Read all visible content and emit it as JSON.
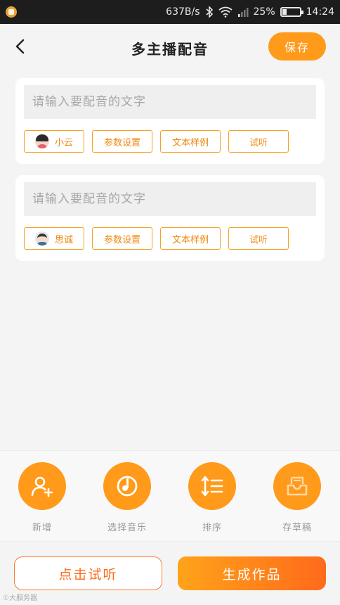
{
  "status_bar": {
    "speed": "637B/s",
    "battery": "25%",
    "battery_level": 0.25,
    "time": "14:24"
  },
  "header": {
    "title": "多主播配音",
    "save_label": "保存"
  },
  "cards": [
    {
      "placeholder": "请输入要配音的文字",
      "voice_name": "小云",
      "params_label": "参数设置",
      "sample_label": "文本样例",
      "listen_label": "试听"
    },
    {
      "placeholder": "请输入要配音的文字",
      "voice_name": "思诚",
      "params_label": "参数设置",
      "sample_label": "文本样例",
      "listen_label": "试听"
    }
  ],
  "toolbar": {
    "items": [
      {
        "label": "新增",
        "icon": "add-user-icon"
      },
      {
        "label": "选择音乐",
        "icon": "music-disc-icon"
      },
      {
        "label": "排序",
        "icon": "sort-icon"
      },
      {
        "label": "存草稿",
        "icon": "draft-box-icon"
      }
    ]
  },
  "actions": {
    "listen_label": "点击试听",
    "generate_label": "生成作品"
  },
  "watermark": "①大服务器",
  "colors": {
    "accent": "#ff9a1a",
    "accent_dark": "#ff6a1a",
    "chip_text": "#ef8a10"
  }
}
